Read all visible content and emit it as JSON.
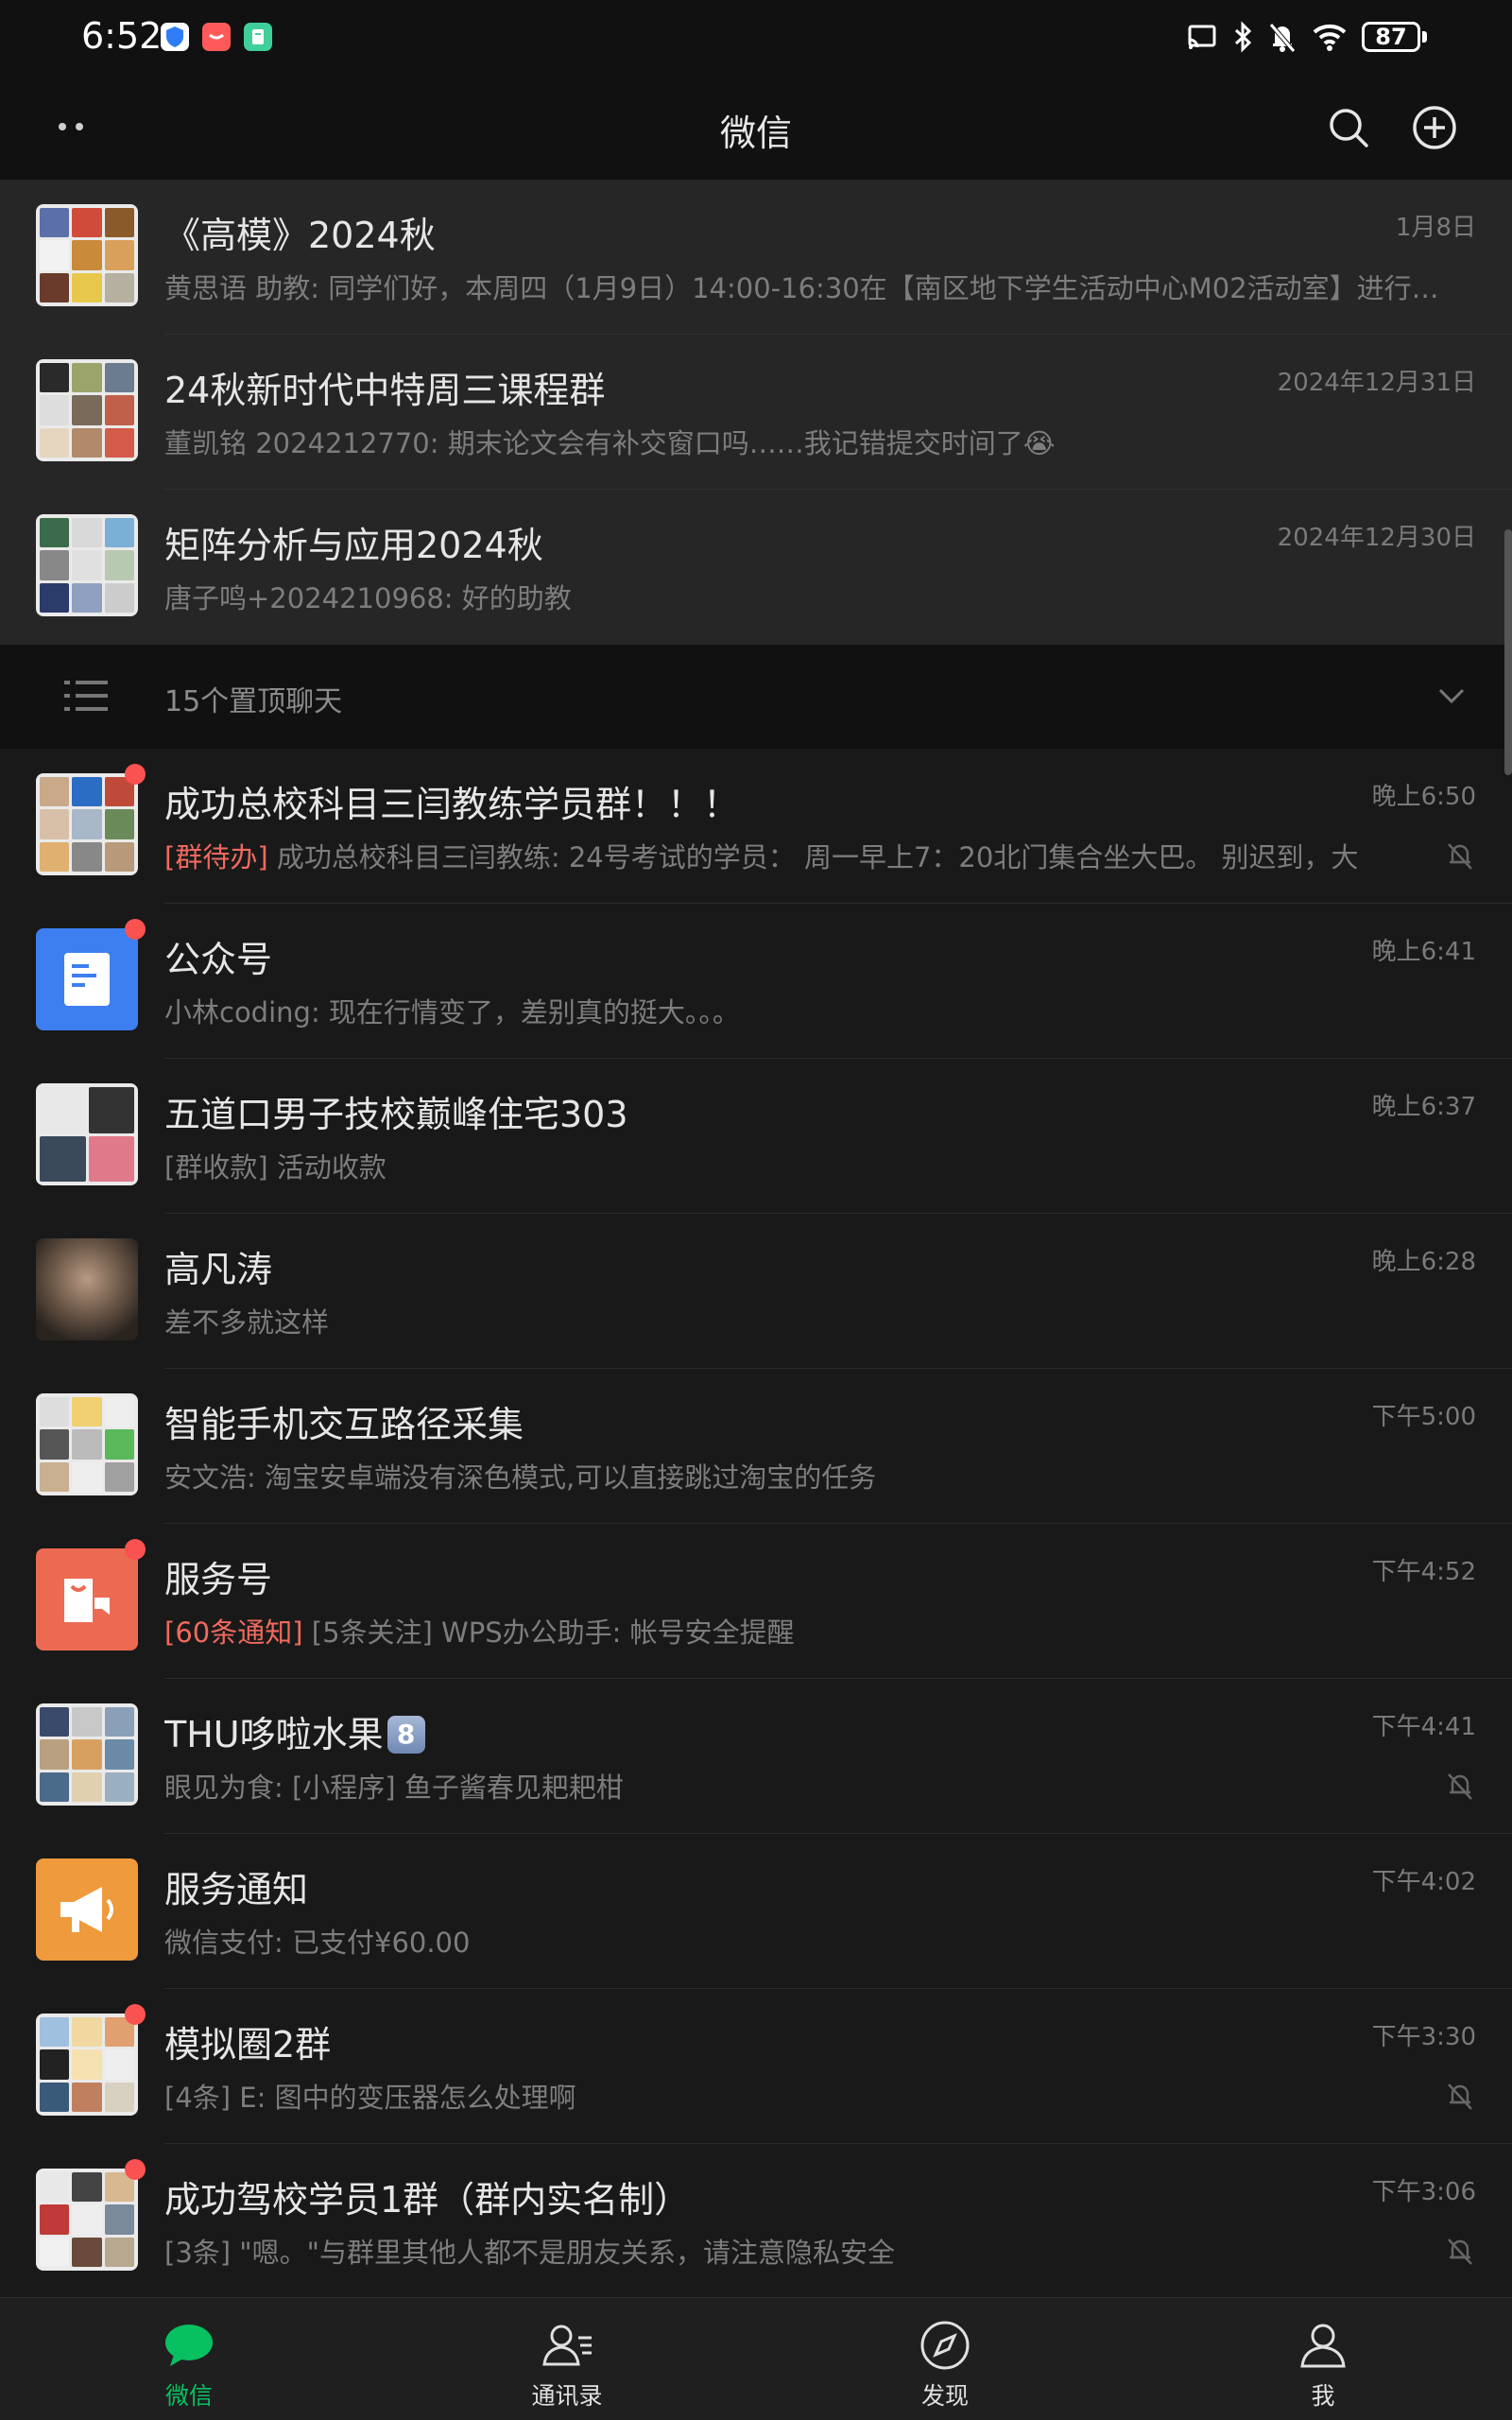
{
  "status_bar": {
    "time": "6:52",
    "battery": "87"
  },
  "header": {
    "title": "微信"
  },
  "pinned_chats": [
    {
      "name": "《高模》2024秋",
      "time": "1月8日",
      "preview": "黄思语 助教: 同学们好，本周四（1月9日）14:00-16:30在【南区地下学生活动中心M02活动室】进行…"
    },
    {
      "name": "24秋新时代中特周三课程群",
      "time": "2024年12月31日",
      "preview": "董凯铭 2024212770: 期末论文会有补交窗口吗……我记错提交时间了😭"
    },
    {
      "name": "矩阵分析与应用2024秋",
      "time": "2024年12月30日",
      "preview": "唐子鸣+2024210968: 好的助教"
    }
  ],
  "pinned_bar": {
    "label": "15个置顶聊天"
  },
  "chats": [
    {
      "name": "成功总校科目三闫教练学员群！！！",
      "time": "晚上6:50",
      "tag": "[群待办]",
      "preview": " 成功总校科目三闫教练: 24号考试的学员：  周一早上7：20北门集合坐大巴。 别迟到，大"
    },
    {
      "name": "公众号",
      "time": "晚上6:41",
      "tag": "",
      "preview": "小林coding: 现在行情变了，差别真的挺大。。。"
    },
    {
      "name": "五道口男子技校巅峰住宅303",
      "time": "晚上6:37",
      "tag": "",
      "preview": "[群收款] 活动收款"
    },
    {
      "name": "高凡涛",
      "time": "晚上6:28",
      "tag": "",
      "preview": "差不多就这样"
    },
    {
      "name": "智能手机交互路径采集",
      "time": "下午5:00",
      "tag": "",
      "preview": "安文浩: 淘宝安卓端没有深色模式,可以直接跳过淘宝的任务"
    },
    {
      "name": "服务号",
      "time": "下午4:52",
      "tag": "[60条通知]",
      "preview": " [5条关注] WPS办公助手: 帐号安全提醒"
    },
    {
      "name": "THU哆啦水果",
      "badge": "8",
      "time": "下午4:41",
      "tag": "",
      "preview": "眼见为食: [小程序] 鱼子酱春见耙耙柑"
    },
    {
      "name": "服务通知",
      "time": "下午4:02",
      "tag": "",
      "preview": "微信支付:  已支付¥60.00"
    },
    {
      "name": "模拟圈2群",
      "time": "下午3:30",
      "tag": "",
      "preview": "[4条] E: 图中的变压器怎么处理啊"
    },
    {
      "name": "成功驾校学员1群（群内实名制）",
      "time": "下午3:06",
      "tag": "",
      "preview": "[3条] \"嗯。\"与群里其他人都不是朋友关系，请注意隐私安全"
    }
  ],
  "tabs": [
    {
      "label": "微信",
      "icon": "chat-bubble-icon",
      "active": true
    },
    {
      "label": "通讯录",
      "icon": "contacts-icon",
      "active": false
    },
    {
      "label": "发现",
      "icon": "compass-icon",
      "active": false
    },
    {
      "label": "我",
      "icon": "person-icon",
      "active": false
    }
  ],
  "colors": {
    "accent": "#07c160",
    "unread": "#fa5151",
    "background": "#191919"
  }
}
